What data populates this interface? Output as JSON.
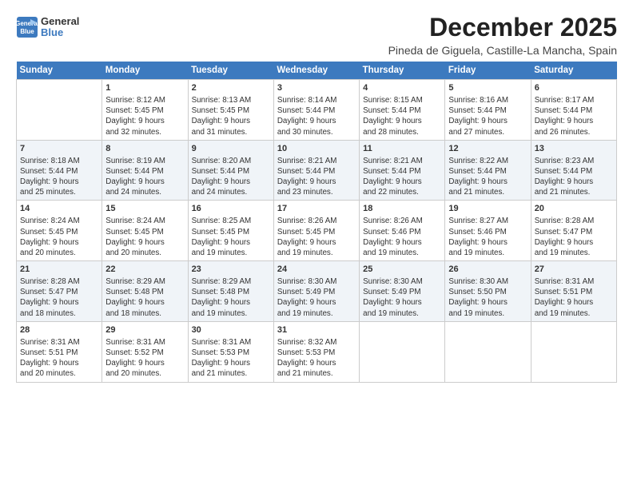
{
  "logo": {
    "line1": "General",
    "line2": "Blue"
  },
  "title": "December 2025",
  "subtitle": "Pineda de Giguela, Castille-La Mancha, Spain",
  "headers": [
    "Sunday",
    "Monday",
    "Tuesday",
    "Wednesday",
    "Thursday",
    "Friday",
    "Saturday"
  ],
  "weeks": [
    [
      {
        "day": "",
        "content": ""
      },
      {
        "day": "1",
        "content": "Sunrise: 8:12 AM\nSunset: 5:45 PM\nDaylight: 9 hours\nand 32 minutes."
      },
      {
        "day": "2",
        "content": "Sunrise: 8:13 AM\nSunset: 5:45 PM\nDaylight: 9 hours\nand 31 minutes."
      },
      {
        "day": "3",
        "content": "Sunrise: 8:14 AM\nSunset: 5:44 PM\nDaylight: 9 hours\nand 30 minutes."
      },
      {
        "day": "4",
        "content": "Sunrise: 8:15 AM\nSunset: 5:44 PM\nDaylight: 9 hours\nand 28 minutes."
      },
      {
        "day": "5",
        "content": "Sunrise: 8:16 AM\nSunset: 5:44 PM\nDaylight: 9 hours\nand 27 minutes."
      },
      {
        "day": "6",
        "content": "Sunrise: 8:17 AM\nSunset: 5:44 PM\nDaylight: 9 hours\nand 26 minutes."
      }
    ],
    [
      {
        "day": "7",
        "content": "Sunrise: 8:18 AM\nSunset: 5:44 PM\nDaylight: 9 hours\nand 25 minutes."
      },
      {
        "day": "8",
        "content": "Sunrise: 8:19 AM\nSunset: 5:44 PM\nDaylight: 9 hours\nand 24 minutes."
      },
      {
        "day": "9",
        "content": "Sunrise: 8:20 AM\nSunset: 5:44 PM\nDaylight: 9 hours\nand 24 minutes."
      },
      {
        "day": "10",
        "content": "Sunrise: 8:21 AM\nSunset: 5:44 PM\nDaylight: 9 hours\nand 23 minutes."
      },
      {
        "day": "11",
        "content": "Sunrise: 8:21 AM\nSunset: 5:44 PM\nDaylight: 9 hours\nand 22 minutes."
      },
      {
        "day": "12",
        "content": "Sunrise: 8:22 AM\nSunset: 5:44 PM\nDaylight: 9 hours\nand 21 minutes."
      },
      {
        "day": "13",
        "content": "Sunrise: 8:23 AM\nSunset: 5:44 PM\nDaylight: 9 hours\nand 21 minutes."
      }
    ],
    [
      {
        "day": "14",
        "content": "Sunrise: 8:24 AM\nSunset: 5:45 PM\nDaylight: 9 hours\nand 20 minutes."
      },
      {
        "day": "15",
        "content": "Sunrise: 8:24 AM\nSunset: 5:45 PM\nDaylight: 9 hours\nand 20 minutes."
      },
      {
        "day": "16",
        "content": "Sunrise: 8:25 AM\nSunset: 5:45 PM\nDaylight: 9 hours\nand 19 minutes."
      },
      {
        "day": "17",
        "content": "Sunrise: 8:26 AM\nSunset: 5:45 PM\nDaylight: 9 hours\nand 19 minutes."
      },
      {
        "day": "18",
        "content": "Sunrise: 8:26 AM\nSunset: 5:46 PM\nDaylight: 9 hours\nand 19 minutes."
      },
      {
        "day": "19",
        "content": "Sunrise: 8:27 AM\nSunset: 5:46 PM\nDaylight: 9 hours\nand 19 minutes."
      },
      {
        "day": "20",
        "content": "Sunrise: 8:28 AM\nSunset: 5:47 PM\nDaylight: 9 hours\nand 19 minutes."
      }
    ],
    [
      {
        "day": "21",
        "content": "Sunrise: 8:28 AM\nSunset: 5:47 PM\nDaylight: 9 hours\nand 18 minutes."
      },
      {
        "day": "22",
        "content": "Sunrise: 8:29 AM\nSunset: 5:48 PM\nDaylight: 9 hours\nand 18 minutes."
      },
      {
        "day": "23",
        "content": "Sunrise: 8:29 AM\nSunset: 5:48 PM\nDaylight: 9 hours\nand 19 minutes."
      },
      {
        "day": "24",
        "content": "Sunrise: 8:30 AM\nSunset: 5:49 PM\nDaylight: 9 hours\nand 19 minutes."
      },
      {
        "day": "25",
        "content": "Sunrise: 8:30 AM\nSunset: 5:49 PM\nDaylight: 9 hours\nand 19 minutes."
      },
      {
        "day": "26",
        "content": "Sunrise: 8:30 AM\nSunset: 5:50 PM\nDaylight: 9 hours\nand 19 minutes."
      },
      {
        "day": "27",
        "content": "Sunrise: 8:31 AM\nSunset: 5:51 PM\nDaylight: 9 hours\nand 19 minutes."
      }
    ],
    [
      {
        "day": "28",
        "content": "Sunrise: 8:31 AM\nSunset: 5:51 PM\nDaylight: 9 hours\nand 20 minutes."
      },
      {
        "day": "29",
        "content": "Sunrise: 8:31 AM\nSunset: 5:52 PM\nDaylight: 9 hours\nand 20 minutes."
      },
      {
        "day": "30",
        "content": "Sunrise: 8:31 AM\nSunset: 5:53 PM\nDaylight: 9 hours\nand 21 minutes."
      },
      {
        "day": "31",
        "content": "Sunrise: 8:32 AM\nSunset: 5:53 PM\nDaylight: 9 hours\nand 21 minutes."
      },
      {
        "day": "",
        "content": ""
      },
      {
        "day": "",
        "content": ""
      },
      {
        "day": "",
        "content": ""
      }
    ]
  ]
}
